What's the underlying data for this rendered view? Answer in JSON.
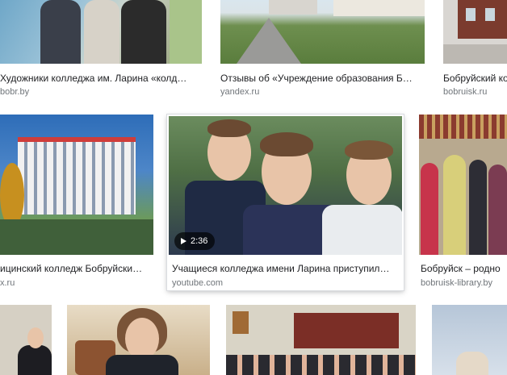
{
  "rows": [
    [
      {
        "title": "Художники колледжа им. Ларина «колд…",
        "source": "bobr.by"
      },
      {
        "title": "Отзывы об «Учреждение образования Б…",
        "source": "yandex.ru"
      },
      {
        "title": "Бобруйский колледж",
        "source": "bobruisk.ru"
      }
    ],
    [
      {
        "title": "ицинский колледж Бобруйски…",
        "source": "x.ru"
      },
      {
        "title": "Учащиеся колледжа имени Ларина приступил…",
        "source": "youtube.com",
        "duration": "2:36"
      },
      {
        "title": "Бобруйск – родно",
        "source": "bobruisk-library.by"
      }
    ]
  ],
  "colors": {
    "title": "#202124",
    "source": "#70757a",
    "badge_bg": "rgba(0,0,0,.65)"
  },
  "icons": {
    "play": "play-icon"
  }
}
